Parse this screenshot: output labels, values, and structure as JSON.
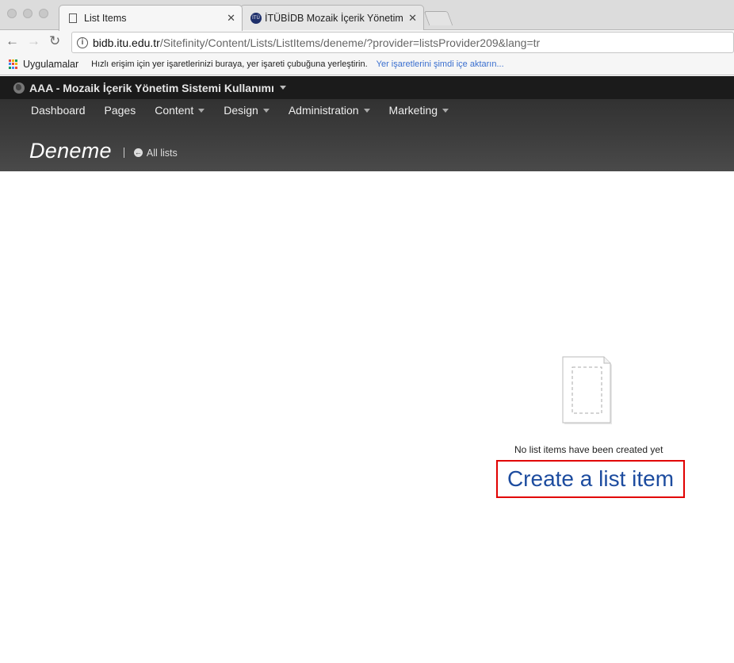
{
  "browser": {
    "tabs": [
      {
        "title": "List Items",
        "active": true
      },
      {
        "title": "İTÜBİDB Mozaik İçerik Yönetim",
        "active": false
      }
    ],
    "url": {
      "host": "bidb.itu.edu.tr",
      "path": "/Sitefinity/Content/Lists/ListItems/deneme/?provider=listsProvider209&lang=tr"
    },
    "bookmarks": {
      "apps_label": "Uygulamalar",
      "hint": "Hızlı erişim için yer işaretlerinizi buraya, yer işareti çubuğuna yerleştirin.",
      "import_link": "Yer işaretlerini şimdi içe aktarın..."
    }
  },
  "app": {
    "site_title": "AAA - Mozaik İçerik Yönetim Sistemi Kullanımı",
    "nav": [
      "Dashboard",
      "Pages",
      "Content",
      "Design",
      "Administration",
      "Marketing"
    ],
    "page_title": "Deneme",
    "back_link": "All lists"
  },
  "empty_state": {
    "message": "No list items have been created yet",
    "create_link": "Create a list item"
  },
  "colors": {
    "link": "#1d4c9f",
    "highlight_border": "#e10000",
    "bookmark_link": "#3a6fcf"
  }
}
